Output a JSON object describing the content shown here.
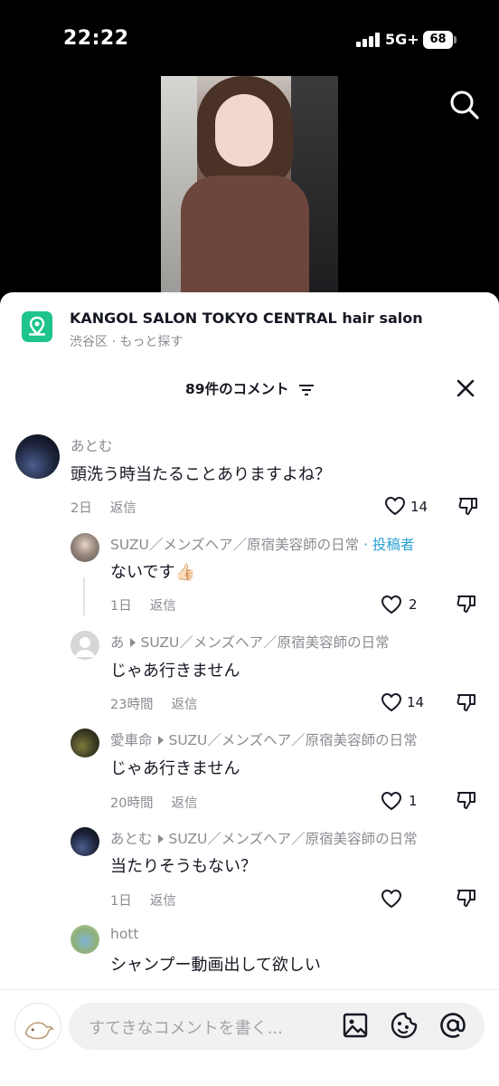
{
  "status": {
    "time": "22:22",
    "network": "5G+",
    "battery": "68"
  },
  "poi": {
    "name": "KANGOL SALON TOKYO CENTRAL hair salon",
    "subtitle": "渋谷区 · もっと探す"
  },
  "comments_header": {
    "count_label": "89件のコメント"
  },
  "comments": [
    {
      "user": "あとむ",
      "text": "頭洗う時当たることありますよね？",
      "time": "2日",
      "reply": "返信",
      "likes": "14"
    },
    {
      "user": "SUZU／メンズヘア／原宿美容師の日常",
      "author_tag": "· 投稿者",
      "text": "ないです👍🏻",
      "time": "1日",
      "reply": "返信",
      "likes": "2"
    },
    {
      "user": "あ",
      "reply_to": "SUZU／メンズヘア／原宿美容師の日常",
      "text": "じゃあ行きません",
      "time": "23時間",
      "reply": "返信",
      "likes": "14"
    },
    {
      "user": "愛車命",
      "reply_to": "SUZU／メンズヘア／原宿美容師の日常",
      "text": "じゃあ行きません",
      "time": "20時間",
      "reply": "返信",
      "likes": "1"
    },
    {
      "user": "あとむ",
      "reply_to": "SUZU／メンズヘア／原宿美容師の日常",
      "text": "当たりそうもない？",
      "time": "1日",
      "reply": "返信",
      "likes": ""
    },
    {
      "user": "hott",
      "text": "シャンプー動画出して欲しい"
    }
  ],
  "input": {
    "placeholder": "すてきなコメントを書く..."
  },
  "colors": {
    "accent_author": "#2b9fd6",
    "poi_icon": "#1ec48a"
  },
  "icons": [
    "search-icon",
    "location-pin-icon",
    "filter-icon",
    "close-icon",
    "heart-icon",
    "thumbs-down-icon",
    "image-icon",
    "emoji-icon",
    "mention-icon"
  ]
}
